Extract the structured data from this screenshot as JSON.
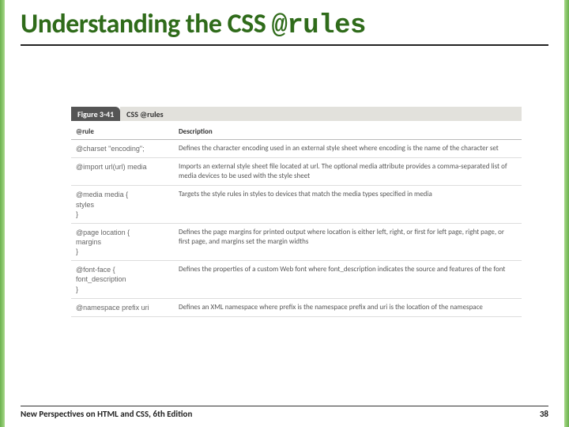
{
  "title": {
    "prefix": "Understanding the CSS ",
    "code": "@rules"
  },
  "figure": {
    "label": "Figure 3-41",
    "caption": "CSS @rules"
  },
  "table": {
    "headers": {
      "rule": "@rule",
      "desc": "Description"
    },
    "rows": [
      {
        "rule": "@charset \"encoding\";",
        "desc": "Defines the character encoding used in an external style sheet where encoding is the name of the character set"
      },
      {
        "rule": "@import url(url) media",
        "desc": "Imports an external style sheet file located at url. The optional media attribute provides a comma-separated list of media devices to be used with the style sheet"
      },
      {
        "rule": "@media media {\n  styles\n}",
        "desc": "Targets the style rules in styles to devices that match the media types specified in media"
      },
      {
        "rule": "@page location {\n  margins\n}",
        "desc": "Defines the page margins for printed output where location is either left, right, or first for left page, right page, or first page, and margins set the margin widths"
      },
      {
        "rule": "@font-face {\n  font_description\n}",
        "desc": "Defines the properties of a custom Web font where font_description indicates the source and features of the font"
      },
      {
        "rule": "@namespace prefix uri",
        "desc": "Defines an XML namespace where prefix is the namespace prefix and uri is the location of the namespace"
      }
    ]
  },
  "footer": {
    "book": "New Perspectives on HTML and CSS, 6th Edition",
    "page": "38"
  }
}
